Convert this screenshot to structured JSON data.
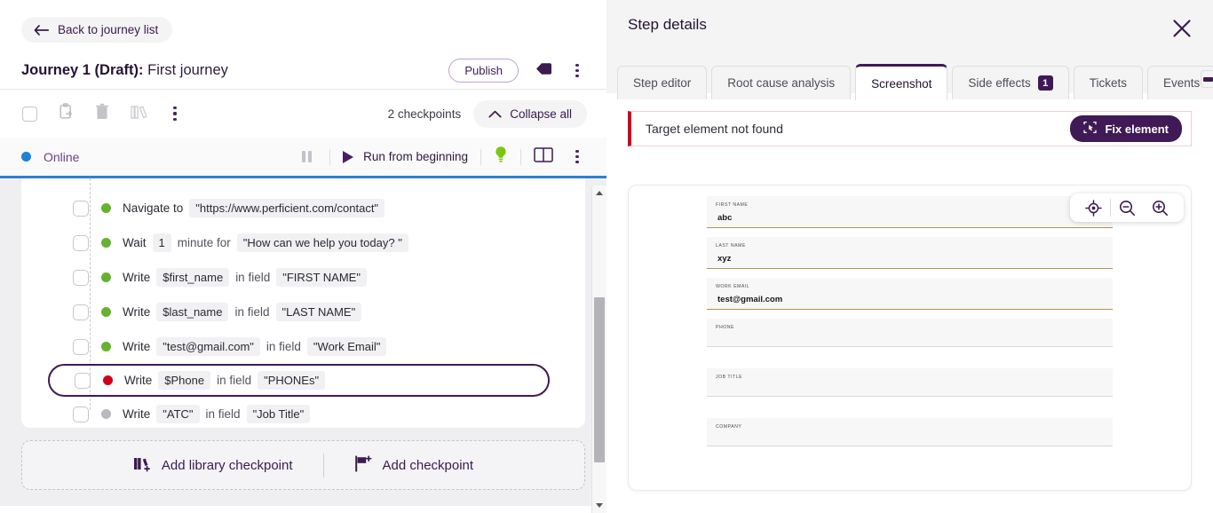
{
  "left": {
    "back_button": "Back to journey list",
    "journey_prefix": "Journey 1 (Draft):",
    "journey_name": "First journey",
    "publish_label": "Publish",
    "toolbar": {
      "checkpoint_count": "2 checkpoints",
      "collapse_label": "Collapse all",
      "icons": [
        "select-all-checkbox",
        "paste-icon",
        "trash-icon",
        "library-icon",
        "more-options-icon"
      ]
    },
    "runbar": {
      "status": "Online",
      "status_color": "#1d82d8",
      "run_label": "Run from beginning",
      "icons": [
        "pause-icon",
        "play-icon",
        "lightbulb-icon",
        "split-view-icon",
        "more-options-icon"
      ]
    },
    "steps": [
      {
        "status": "green",
        "parts": [
          {
            "t": "text",
            "v": "Navigate to"
          },
          {
            "t": "chip",
            "v": "\"https://www.perficient.com/contact\""
          }
        ]
      },
      {
        "status": "green",
        "parts": [
          {
            "t": "text",
            "v": "Wait"
          },
          {
            "t": "chip",
            "v": "1"
          },
          {
            "t": "muted",
            "v": "minute for"
          },
          {
            "t": "chip",
            "v": "\"How can we help you today? \""
          }
        ]
      },
      {
        "status": "green",
        "parts": [
          {
            "t": "text",
            "v": "Write"
          },
          {
            "t": "chip",
            "v": "$first_name"
          },
          {
            "t": "muted",
            "v": "in field"
          },
          {
            "t": "chip",
            "v": "\"FIRST NAME\""
          }
        ]
      },
      {
        "status": "green",
        "parts": [
          {
            "t": "text",
            "v": "Write"
          },
          {
            "t": "chip",
            "v": "$last_name"
          },
          {
            "t": "muted",
            "v": "in field"
          },
          {
            "t": "chip",
            "v": "\"LAST NAME\""
          }
        ]
      },
      {
        "status": "green",
        "parts": [
          {
            "t": "text",
            "v": "Write"
          },
          {
            "t": "chip",
            "v": "\"test@gmail.com\""
          },
          {
            "t": "muted",
            "v": "in field"
          },
          {
            "t": "chip",
            "v": "\"Work Email\""
          }
        ]
      },
      {
        "status": "red",
        "selected": true,
        "parts": [
          {
            "t": "text",
            "v": "Write"
          },
          {
            "t": "chip",
            "v": "$Phone"
          },
          {
            "t": "muted",
            "v": "in field"
          },
          {
            "t": "chip",
            "v": "\"PHONEs\""
          }
        ]
      },
      {
        "status": "gray",
        "parts": [
          {
            "t": "text",
            "v": "Write"
          },
          {
            "t": "chip",
            "v": "\"ATC\""
          },
          {
            "t": "muted",
            "v": "in field"
          },
          {
            "t": "chip",
            "v": "\"Job Title\""
          }
        ]
      }
    ],
    "footer": {
      "add_library_label": "Add library checkpoint",
      "add_checkpoint_label": "Add checkpoint"
    }
  },
  "right": {
    "title": "Step details",
    "close_icon": "close-icon",
    "tabs": [
      {
        "label": "Step editor",
        "active": false
      },
      {
        "label": "Root cause analysis",
        "active": false
      },
      {
        "label": "Screenshot",
        "active": true
      },
      {
        "label": "Side effects",
        "active": false,
        "badge": "1"
      },
      {
        "label": "Tickets",
        "active": false
      },
      {
        "label": "Events",
        "active": false
      }
    ],
    "error": {
      "message": "Target element not found",
      "fix_label": "Fix element",
      "accent_color": "#d0021b"
    },
    "shot_tools": [
      "target-icon",
      "zoom-out-icon",
      "zoom-in-icon"
    ],
    "screenshot_form": [
      {
        "label": "FIRST NAME",
        "value": "abc",
        "filled": true
      },
      {
        "label": "LAST NAME",
        "value": "xyz",
        "filled": true
      },
      {
        "label": "WORK EMAIL",
        "value": "test@gmail.com",
        "filled": true
      },
      {
        "label": "PHONE",
        "value": "",
        "filled": false
      },
      {
        "label": "JOB TITLE",
        "value": "",
        "filled": false
      },
      {
        "label": "COMPANY",
        "value": "",
        "filled": false
      }
    ]
  }
}
